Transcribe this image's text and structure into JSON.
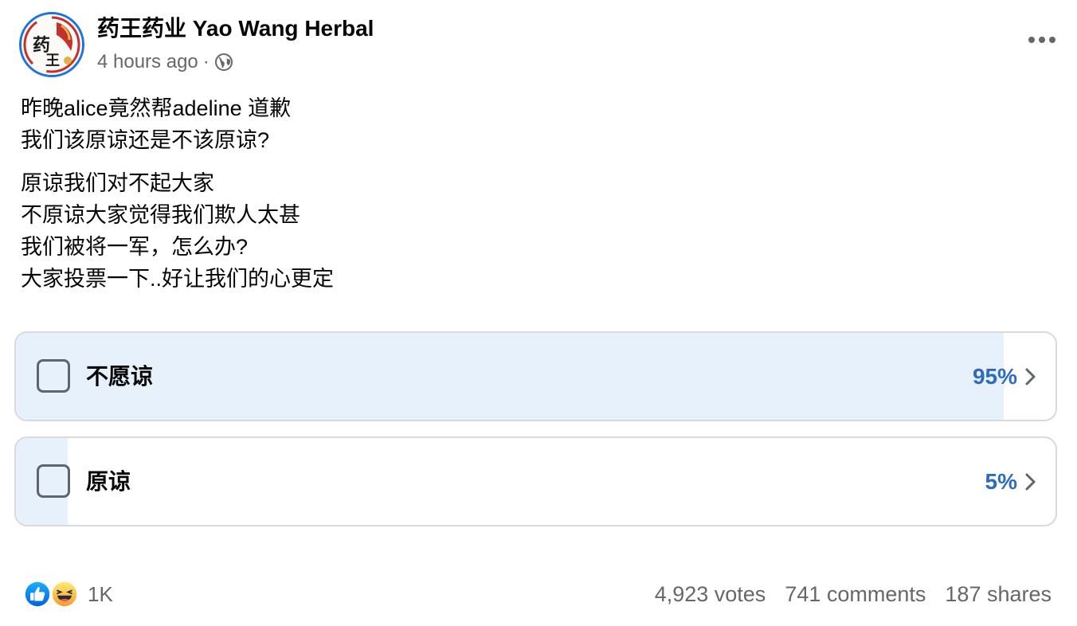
{
  "post": {
    "page_name": "药王药业 Yao Wang Herbal",
    "timestamp": "4 hours ago",
    "separator": "·",
    "privacy_icon": "globe-icon",
    "menu_icon": "more-horizontal-icon",
    "avatar_text": "药王",
    "paragraphs": [
      [
        "昨晚alice竟然帮adeline 道歉",
        "我们该原谅还是不该原谅?"
      ],
      [
        "原谅我们对不起大家",
        "不原谅大家觉得我们欺人太甚",
        "我们被将一军，怎么办?",
        "大家投票一下..好让我们的心更定"
      ]
    ]
  },
  "poll": {
    "options": [
      {
        "label": "不愿谅",
        "percent_text": "95%",
        "percent": 95
      },
      {
        "label": "原谅",
        "percent_text": "5%",
        "percent": 5
      }
    ]
  },
  "footer": {
    "reaction_icons": [
      "like-icon",
      "haha-icon"
    ],
    "reaction_count": "1K",
    "votes": "4,923 votes",
    "comments": "741 comments",
    "shares": "187 shares"
  },
  "colors": {
    "accent": "#1b74e4",
    "poll_fill": "#e7f1fc",
    "percent_text": "#2c6bc0",
    "secondary_text": "#65676b"
  }
}
